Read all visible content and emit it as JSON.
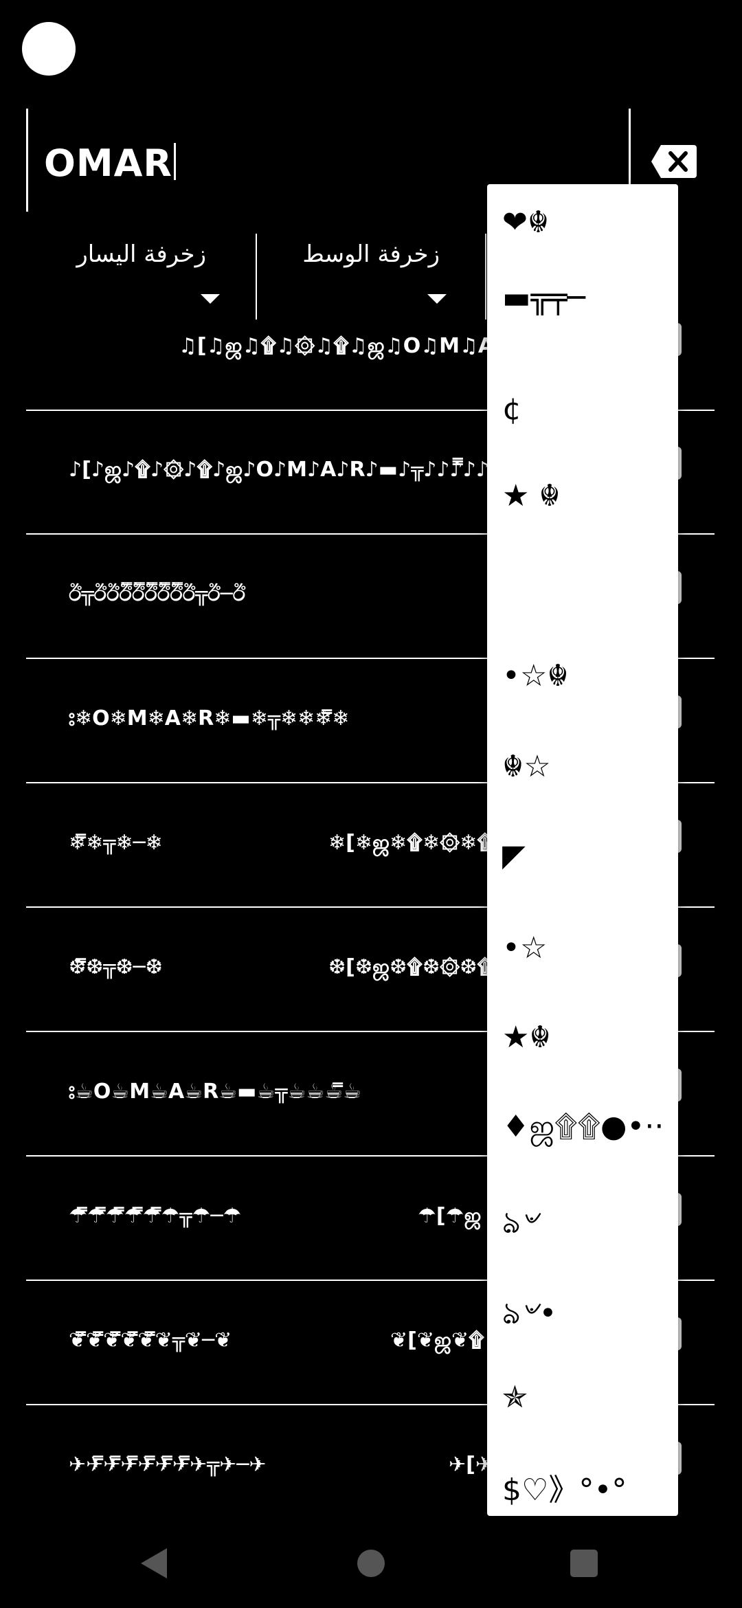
{
  "input": {
    "value": "OMAR"
  },
  "clear_button": {
    "icon": "backspace-clear-icon"
  },
  "dropdowns": [
    {
      "label": "زخرفة اليسار"
    },
    {
      "label": "زخرفة الوسط"
    }
  ],
  "results": [
    {
      "text": "♫[♫ஜ♫۩♫۞♫۩♫ஜ♫O♫M♫A♫R♫"
    },
    {
      "text": "♪[♪ஜ♪۩♪۞♪۩♪ஜ♪O♪M♪A♪R♪▬♪╦♪♪♪̿̿̿♪♪♪♪╦"
    },
    {
      "text": "ඊ╦ඊඊඊ̿ඊ̿ඊ̿ඊ̿ඊ̿ඊ╦ඊ─ඊ"
    },
    {
      "text": "⦂❄O❄M❄A❄R❄▬❄╦❄❄❄̿❄"
    },
    {
      "text": "❄̿❄╦❄─❄",
      "text2": "❄[❄ஜ❄۩❄۞❄۩"
    },
    {
      "text": "❆̿❆╦❆─❆",
      "text2": "❆[❆ஜ❆۩❆۞❆۩"
    },
    {
      "text": "⦂☕O☕M☕A☕R☕▬☕╦☕☕☕̿☕"
    },
    {
      "text": "☂̿☂̿☂̿☂̿☂̿☂╦☂─☂",
      "text2": "☂[☂ஜ"
    },
    {
      "text": "❦̿❦̿❦̿❦̿❦̿❦╦❦─❦",
      "text2": "❦[❦ஜ❦۩"
    },
    {
      "text": "✈✈̿✈̿✈̿✈̿✈̿✈̿✈╦✈─✈",
      "text2": "✈[✈"
    }
  ],
  "popup": {
    "items": [
      {
        "text": "❤☬"
      },
      {
        "text": "▬╦╤─"
      },
      {
        "text": "¢"
      },
      {
        "text": "★ ☬"
      },
      {
        "text": ""
      },
      {
        "text": "•☆☬"
      },
      {
        "text": "☬☆"
      },
      {
        "text": "◤"
      },
      {
        "text": "•☆"
      },
      {
        "text": "★☬"
      },
      {
        "text": "♦ஜ۩۩●•··"
      },
      {
        "text": "ঌ৺"
      },
      {
        "text": "ঌ৺•"
      },
      {
        "text": "✯"
      },
      {
        "text": "$♡》°•°"
      }
    ]
  },
  "navbar": {
    "back": "back-icon",
    "home": "home-icon",
    "recents": "recents-icon"
  }
}
